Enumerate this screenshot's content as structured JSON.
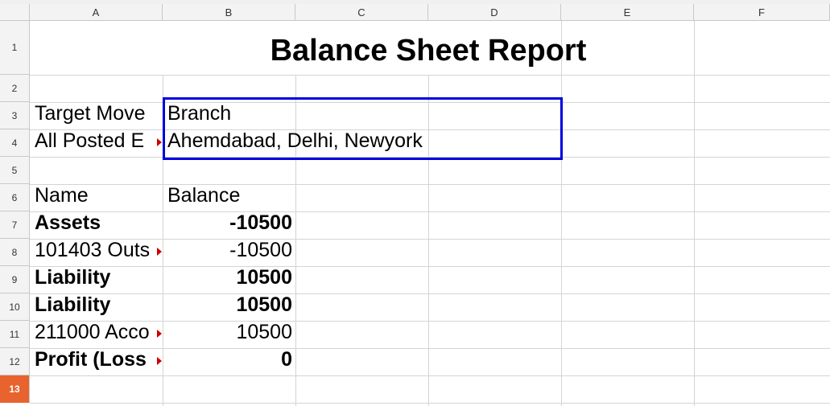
{
  "columns": [
    "A",
    "B",
    "C",
    "D",
    "E",
    "F"
  ],
  "rows": [
    "1",
    "2",
    "3",
    "4",
    "5",
    "6",
    "7",
    "8",
    "9",
    "10",
    "11",
    "12",
    "13"
  ],
  "active_row": "13",
  "cells": {
    "title": "Balance Sheet Report",
    "a3": "Target Move",
    "b3": "Branch",
    "a4": "All Posted E",
    "b4": "Ahemdabad, Delhi, Newyork",
    "a6": "Name",
    "b6": "Balance",
    "a7": "Assets",
    "b7": "-10500",
    "a8": "101403 Outs",
    "b8": "-10500",
    "a9": "Liability",
    "b9": "10500",
    "a10": "Liability",
    "b10": "10500",
    "a11": "211000 Acco",
    "b11": "10500",
    "a12": "Profit (Loss",
    "b12": "0"
  },
  "selection_color": "#0000e0",
  "active_row_color": "#e8632d"
}
